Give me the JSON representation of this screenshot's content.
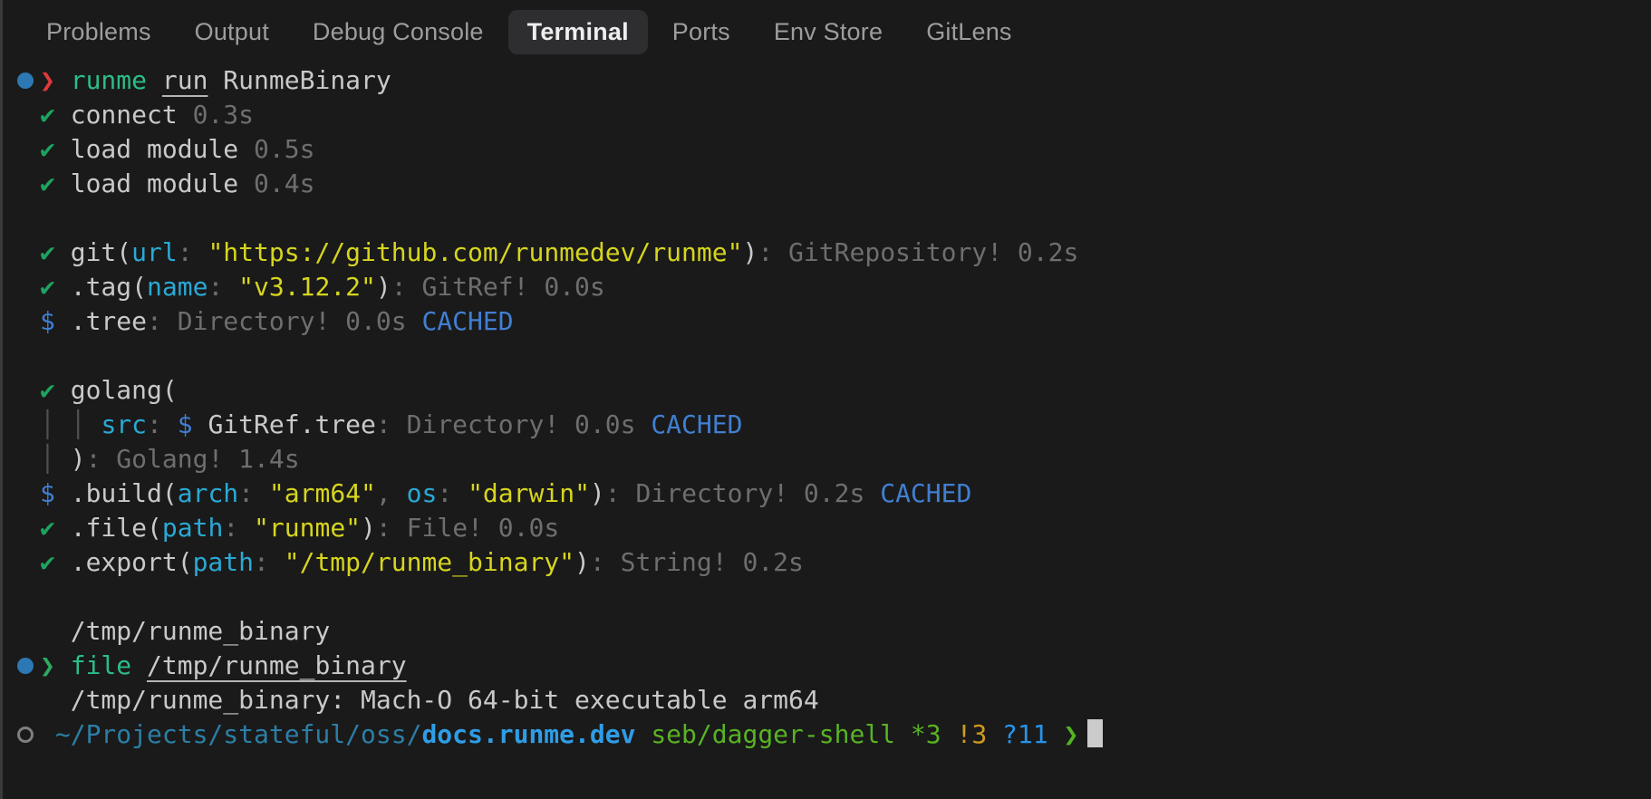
{
  "colors": {
    "bg": "#1a1a1a",
    "text": "#c9c9c9",
    "gray": "#6e6e6e",
    "check": "#1da35f",
    "cmd": "#2bbd87",
    "chevRed": "#e03a3a",
    "chevGreen": "#2daa5e",
    "dotBlue": "#2b78b4",
    "cyan": "#2aa9d4",
    "yellow": "#d6d51f",
    "blue": "#417fd2",
    "guide": "#505050",
    "pathTeal": "#2b7fa6",
    "repoBlue": "#2f9de6",
    "lime": "#58b324",
    "amber": "#cf9a20",
    "statBlue": "#2793ea",
    "promptChev": "#52b51f",
    "cursor": "#cbcbcb",
    "tabInactive": "#9d9d9d",
    "tabActive": "#eeeeee",
    "tabActiveBg": "#2e2e31"
  },
  "icons": {
    "running-dot-icon": "●",
    "idle-ring-icon": "○",
    "check-icon": "✔",
    "prompt-chevron-icon": "❯",
    "indent-guide": "│",
    "cursor-block": "█"
  },
  "tabs": {
    "items": [
      {
        "id": "problems",
        "label": "Problems",
        "active": false
      },
      {
        "id": "output",
        "label": "Output",
        "active": false
      },
      {
        "id": "debug-console",
        "label": "Debug Console",
        "active": false
      },
      {
        "id": "terminal",
        "label": "Terminal",
        "active": true
      },
      {
        "id": "ports",
        "label": "Ports",
        "active": false
      },
      {
        "id": "env-store",
        "label": "Env Store",
        "active": false
      },
      {
        "id": "gitlens",
        "label": "GitLens",
        "active": false
      }
    ]
  },
  "terminal": {
    "lines": [
      {
        "g": "dot",
        "segs": [
          {
            "t": "❯ ",
            "c": "chevRed",
            "n": "prompt-chevron-icon"
          },
          {
            "t": "runme",
            "c": "cmd",
            "n": "command-name"
          },
          {
            "t": " ",
            "c": "text"
          },
          {
            "t": "run",
            "c": "text",
            "u": true,
            "n": "terminal-link"
          },
          {
            "t": " RunmeBinary",
            "c": "text",
            "n": "command-arg"
          }
        ]
      },
      {
        "segs": [
          {
            "t": "✔ ",
            "c": "check",
            "n": "check-icon"
          },
          {
            "t": "connect ",
            "c": "text"
          },
          {
            "t": "0.3s",
            "c": "gray",
            "n": "duration"
          }
        ]
      },
      {
        "segs": [
          {
            "t": "✔ ",
            "c": "check",
            "n": "check-icon"
          },
          {
            "t": "load module ",
            "c": "text"
          },
          {
            "t": "0.5s",
            "c": "gray",
            "n": "duration"
          }
        ]
      },
      {
        "segs": [
          {
            "t": "✔ ",
            "c": "check",
            "n": "check-icon"
          },
          {
            "t": "load module ",
            "c": "text"
          },
          {
            "t": "0.4s",
            "c": "gray",
            "n": "duration"
          }
        ]
      },
      {
        "segs": []
      },
      {
        "segs": [
          {
            "t": "✔ ",
            "c": "check",
            "n": "check-icon"
          },
          {
            "t": "git(",
            "c": "text"
          },
          {
            "t": "url",
            "c": "cyan",
            "n": "arg-name"
          },
          {
            "t": ": ",
            "c": "gray"
          },
          {
            "t": "\"https://github.com/runmedev/runme\"",
            "c": "yellow",
            "n": "string-value"
          },
          {
            "t": ")",
            "c": "text"
          },
          {
            "t": ": GitRepository! 0.2s",
            "c": "gray",
            "n": "result-type"
          }
        ]
      },
      {
        "segs": [
          {
            "t": "✔ ",
            "c": "check",
            "n": "check-icon"
          },
          {
            "t": ".tag(",
            "c": "text"
          },
          {
            "t": "name",
            "c": "cyan",
            "n": "arg-name"
          },
          {
            "t": ": ",
            "c": "gray"
          },
          {
            "t": "\"v3.12.2\"",
            "c": "yellow",
            "n": "string-value"
          },
          {
            "t": ")",
            "c": "text"
          },
          {
            "t": ": GitRef! 0.0s",
            "c": "gray",
            "n": "result-type"
          }
        ]
      },
      {
        "segs": [
          {
            "t": "$ ",
            "c": "blue",
            "n": "shell-dollar"
          },
          {
            "t": ".tree",
            "c": "text"
          },
          {
            "t": ": Directory! 0.0s ",
            "c": "gray",
            "n": "result-type"
          },
          {
            "t": "CACHED",
            "c": "blue",
            "n": "cached-badge"
          }
        ]
      },
      {
        "segs": []
      },
      {
        "segs": [
          {
            "t": "✔ ",
            "c": "check",
            "n": "check-icon"
          },
          {
            "t": "golang(",
            "c": "text"
          }
        ]
      },
      {
        "segs": [
          {
            "t": "│ ",
            "c": "guide",
            "n": "indent-guide"
          },
          {
            "t": "│ ",
            "c": "guide",
            "n": "indent-guide"
          },
          {
            "t": "src",
            "c": "cyan",
            "n": "arg-name"
          },
          {
            "t": ": ",
            "c": "gray"
          },
          {
            "t": "$",
            "c": "blue",
            "n": "shell-dollar"
          },
          {
            "t": " GitRef.tree",
            "c": "text"
          },
          {
            "t": ": Directory! 0.0s ",
            "c": "gray",
            "n": "result-type"
          },
          {
            "t": "CACHED",
            "c": "blue",
            "n": "cached-badge"
          }
        ]
      },
      {
        "segs": [
          {
            "t": "│ ",
            "c": "guide",
            "n": "indent-guide"
          },
          {
            "t": ")",
            "c": "text"
          },
          {
            "t": ": Golang! 1.4s",
            "c": "gray",
            "n": "result-type"
          }
        ]
      },
      {
        "segs": [
          {
            "t": "$ ",
            "c": "blue",
            "n": "shell-dollar"
          },
          {
            "t": ".build(",
            "c": "text"
          },
          {
            "t": "arch",
            "c": "cyan",
            "n": "arg-name"
          },
          {
            "t": ": ",
            "c": "gray"
          },
          {
            "t": "\"arm64\"",
            "c": "yellow",
            "n": "string-value"
          },
          {
            "t": ", ",
            "c": "gray"
          },
          {
            "t": "os",
            "c": "cyan",
            "n": "arg-name"
          },
          {
            "t": ": ",
            "c": "gray"
          },
          {
            "t": "\"darwin\"",
            "c": "yellow",
            "n": "string-value"
          },
          {
            "t": ")",
            "c": "text"
          },
          {
            "t": ": Directory! 0.2s ",
            "c": "gray",
            "n": "result-type"
          },
          {
            "t": "CACHED",
            "c": "blue",
            "n": "cached-badge"
          }
        ]
      },
      {
        "segs": [
          {
            "t": "✔ ",
            "c": "check",
            "n": "check-icon"
          },
          {
            "t": ".file(",
            "c": "text"
          },
          {
            "t": "path",
            "c": "cyan",
            "n": "arg-name"
          },
          {
            "t": ": ",
            "c": "gray"
          },
          {
            "t": "\"runme\"",
            "c": "yellow",
            "n": "string-value"
          },
          {
            "t": ")",
            "c": "text"
          },
          {
            "t": ": File! 0.0s",
            "c": "gray",
            "n": "result-type"
          }
        ]
      },
      {
        "segs": [
          {
            "t": "✔ ",
            "c": "check",
            "n": "check-icon"
          },
          {
            "t": ".export(",
            "c": "text"
          },
          {
            "t": "path",
            "c": "cyan",
            "n": "arg-name"
          },
          {
            "t": ": ",
            "c": "gray"
          },
          {
            "t": "\"/tmp/runme_binary\"",
            "c": "yellow",
            "n": "string-value"
          },
          {
            "t": ")",
            "c": "text"
          },
          {
            "t": ": String! 0.2s",
            "c": "gray",
            "n": "result-type"
          }
        ]
      },
      {
        "segs": []
      },
      {
        "segs": [
          {
            "t": "  /tmp/runme_binary",
            "c": "text",
            "n": "command-output"
          }
        ]
      },
      {
        "g": "dot",
        "segs": [
          {
            "t": "❯ ",
            "c": "chevGreen",
            "n": "prompt-chevron-icon"
          },
          {
            "t": "file",
            "c": "cmd",
            "n": "command-name"
          },
          {
            "t": " ",
            "c": "text"
          },
          {
            "t": "/tmp/runme_binary",
            "c": "text",
            "u": true,
            "n": "terminal-link"
          }
        ]
      },
      {
        "segs": [
          {
            "t": "  /tmp/runme_binary: Mach-O 64-bit executable arm64",
            "c": "text",
            "n": "command-output"
          }
        ]
      },
      {
        "g": "ring",
        "segs": [
          {
            "t": " ~/Projects/stateful/oss/",
            "c": "pathTeal",
            "n": "cwd-path"
          },
          {
            "t": "docs.runme.dev",
            "c": "repoBlue",
            "b": true,
            "n": "cwd-repo"
          },
          {
            "t": " ",
            "c": "text"
          },
          {
            "t": "seb/dagger-shell *3",
            "c": "lime",
            "n": "git-branch"
          },
          {
            "t": " ",
            "c": "text"
          },
          {
            "t": "!3",
            "c": "amber",
            "n": "git-modified-count"
          },
          {
            "t": " ",
            "c": "text"
          },
          {
            "t": "?11",
            "c": "statBlue",
            "n": "git-untracked-count"
          },
          {
            "t": " ",
            "c": "text"
          },
          {
            "t": "❯",
            "c": "promptChev",
            "n": "prompt-chevron-icon"
          }
        ],
        "cursor": true
      }
    ]
  }
}
